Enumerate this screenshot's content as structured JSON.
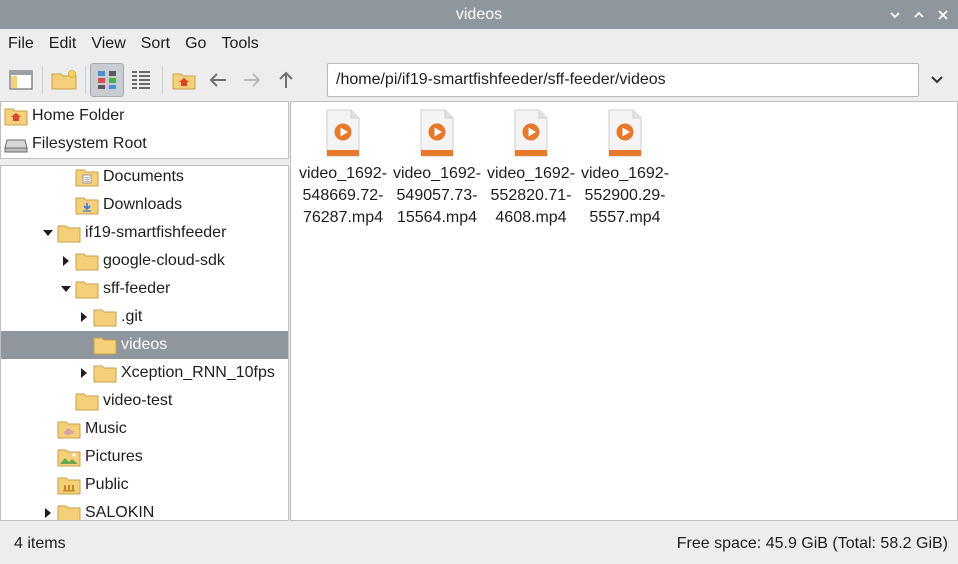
{
  "window": {
    "title": "videos"
  },
  "menu": [
    "File",
    "Edit",
    "View",
    "Sort",
    "Go",
    "Tools"
  ],
  "path": "/home/pi/if19-smartfishfeeder/sff-feeder/videos",
  "places": [
    {
      "label": "Home Folder",
      "icon": "home-folder-icon"
    },
    {
      "label": "Filesystem Root",
      "icon": "drive-icon"
    }
  ],
  "tree": [
    {
      "label": "Documents",
      "indent": 4,
      "expander": "none",
      "icon": "documents-folder-icon"
    },
    {
      "label": "Downloads",
      "indent": 4,
      "expander": "none",
      "icon": "downloads-folder-icon"
    },
    {
      "label": "if19-smartfishfeeder",
      "indent": 3,
      "expander": "open",
      "icon": "folder-icon"
    },
    {
      "label": "google-cloud-sdk",
      "indent": 4,
      "expander": "closed",
      "icon": "folder-icon"
    },
    {
      "label": "sff-feeder",
      "indent": 4,
      "expander": "open",
      "icon": "folder-icon"
    },
    {
      "label": ".git",
      "indent": 5,
      "expander": "closed",
      "icon": "folder-icon"
    },
    {
      "label": "videos",
      "indent": 5,
      "expander": "none",
      "icon": "folder-icon",
      "selected": true
    },
    {
      "label": "Xception_RNN_10fps",
      "indent": 5,
      "expander": "closed",
      "icon": "folder-icon"
    },
    {
      "label": "video-test",
      "indent": 4,
      "expander": "none",
      "icon": "folder-icon"
    },
    {
      "label": "Music",
      "indent": 3,
      "expander": "none",
      "icon": "music-folder-icon"
    },
    {
      "label": "Pictures",
      "indent": 3,
      "expander": "none",
      "icon": "pictures-folder-icon"
    },
    {
      "label": "Public",
      "indent": 3,
      "expander": "none",
      "icon": "public-folder-icon"
    },
    {
      "label": "SALOKIN",
      "indent": 3,
      "expander": "closed",
      "icon": "folder-icon"
    }
  ],
  "files": [
    {
      "name": "video_1692-548669.72-76287.mp4",
      "lines": [
        "video_1692-",
        "548669.72-",
        "76287.mp4"
      ],
      "icon": "video-file-icon"
    },
    {
      "name": "video_1692-549057.73-15564.mp4",
      "lines": [
        "video_1692-",
        "549057.73-",
        "15564.mp4"
      ],
      "icon": "video-file-icon"
    },
    {
      "name": "video_1692-552820.71-4608.mp4",
      "lines": [
        "video_1692-",
        "552820.71-",
        "4608.mp4"
      ],
      "icon": "video-file-icon"
    },
    {
      "name": "video_1692-552900.29-5557.mp4",
      "lines": [
        "video_1692-",
        "552900.29-",
        "5557.mp4"
      ],
      "icon": "video-file-icon"
    }
  ],
  "status": {
    "items": "4 items",
    "free_space": "Free space: 45.9 GiB (Total: 58.2 GiB)"
  },
  "colors": {
    "titlebar": "#8f969d",
    "selection": "#8f969d",
    "folder": "#f5cf7a",
    "video_accent": "#e8782a"
  }
}
